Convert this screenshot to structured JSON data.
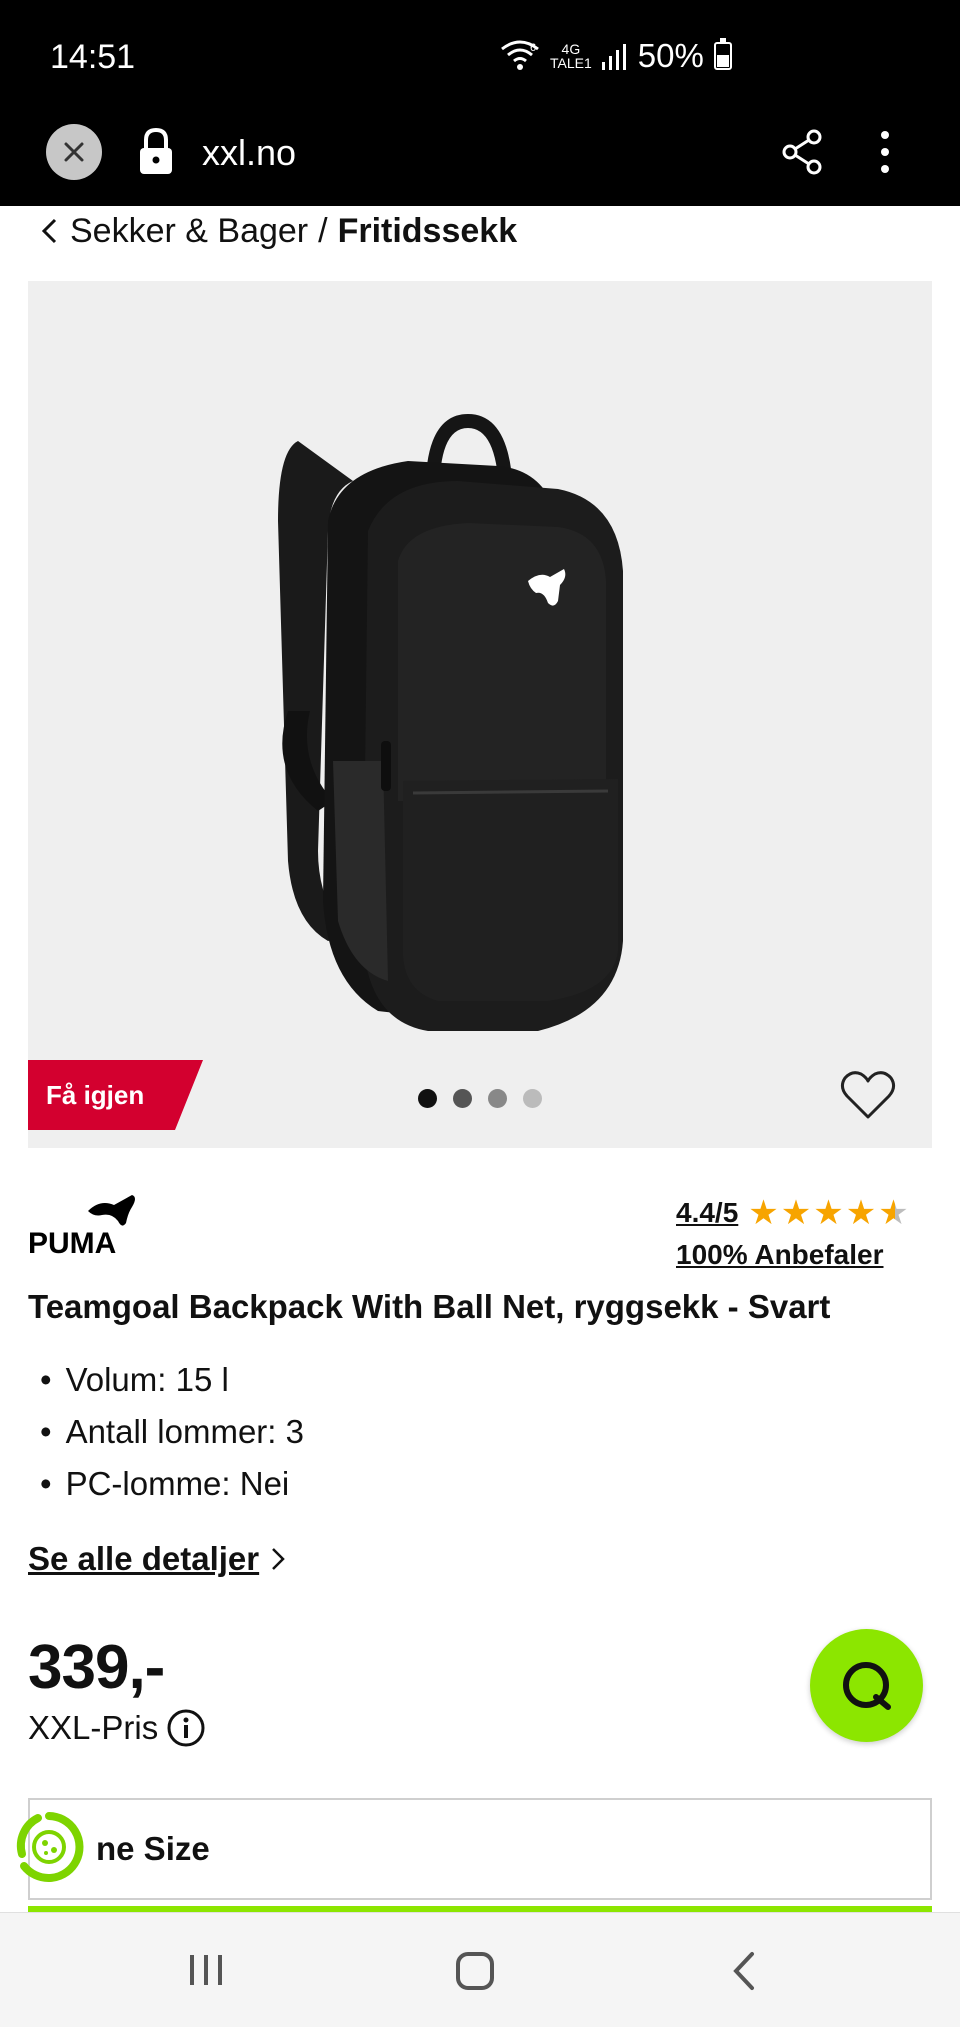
{
  "status_bar": {
    "time": "14:51",
    "net_top": "4G",
    "net_bottom": "TALE1",
    "battery": "50%",
    "battery_level": 0.5
  },
  "browser": {
    "url": "xxl.no"
  },
  "breadcrumb": {
    "parent": "Sekker & Bager",
    "separator": "/",
    "current": "Fritidssekk"
  },
  "gallery": {
    "badge": "Få igjen",
    "dots_count": 4,
    "active_dot": 0
  },
  "product": {
    "brand": "PUMA",
    "rating": "4.4/5",
    "rating_value": 4.4,
    "recommend": "100% Anbefaler",
    "title": "Teamgoal Backpack With Ball Net, ryggsekk - Svart",
    "specs": [
      "Volum: 15 l",
      "Antall lommer: 3",
      "PC-lomme: Nei"
    ],
    "details_link": "Se alle detaljer",
    "price": "339,-",
    "price_label": "XXL-Pris",
    "size_select": "ne Size"
  },
  "colors": {
    "badge_red": "#d3002f",
    "accent_green": "#8ce600",
    "star": "#f7a400"
  },
  "icons": {
    "close": "close-icon",
    "lock": "lock-icon",
    "share": "share-icon",
    "more": "more-vert-icon",
    "back_chevron": "chevron-left-icon",
    "wishlist": "heart-icon",
    "info": "info-icon",
    "chat": "chat-icon",
    "cookie": "cookie-settings-icon"
  }
}
